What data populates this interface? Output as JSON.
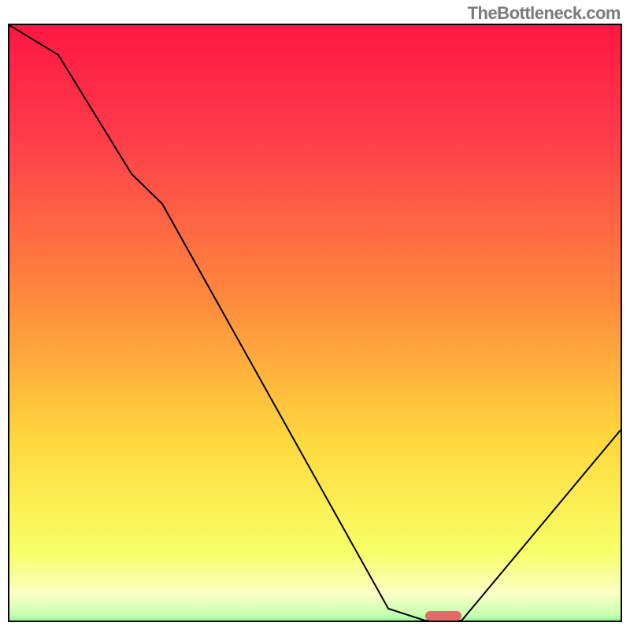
{
  "watermark": "TheBottleneck.com",
  "chart_data": {
    "type": "line",
    "title": "",
    "xlabel": "",
    "ylabel": "",
    "xlim": [
      0,
      100
    ],
    "ylim": [
      0,
      100
    ],
    "series": [
      {
        "name": "bottleneck-curve",
        "x": [
          0,
          8,
          20,
          25,
          62,
          68,
          74,
          100
        ],
        "values": [
          100,
          95,
          75,
          70,
          2,
          0,
          0,
          32
        ]
      }
    ],
    "optimum_marker": {
      "x_start": 68,
      "x_end": 74,
      "y": 0
    },
    "gradient_stops": [
      {
        "pos": 0.0,
        "color": "#ff1744"
      },
      {
        "pos": 0.18,
        "color": "#ff3b4a"
      },
      {
        "pos": 0.45,
        "color": "#ff8a3d"
      },
      {
        "pos": 0.68,
        "color": "#ffd83d"
      },
      {
        "pos": 0.86,
        "color": "#f7ff66"
      },
      {
        "pos": 0.93,
        "color": "#fbffc4"
      },
      {
        "pos": 0.965,
        "color": "#c8ffb0"
      },
      {
        "pos": 1.0,
        "color": "#00e05a"
      }
    ]
  }
}
